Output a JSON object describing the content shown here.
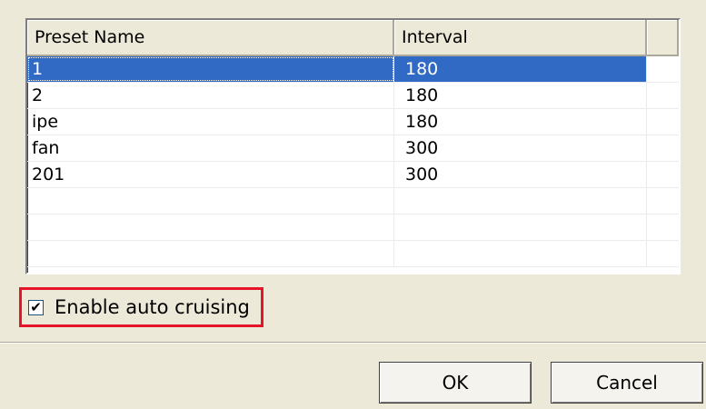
{
  "table": {
    "columns": [
      "Preset Name",
      "Interval",
      ""
    ],
    "rows": [
      {
        "name": "1",
        "interval": "180"
      },
      {
        "name": "2",
        "interval": "180"
      },
      {
        "name": "ipe",
        "interval": "180"
      },
      {
        "name": "fan",
        "interval": "300"
      },
      {
        "name": "201",
        "interval": "300"
      },
      {
        "name": "",
        "interval": ""
      },
      {
        "name": "",
        "interval": ""
      },
      {
        "name": "",
        "interval": ""
      }
    ],
    "selected_row": 0
  },
  "auto_cruise": {
    "label": "Enable auto cruising",
    "checked": true,
    "check_glyph": "✔"
  },
  "buttons": {
    "ok_label": "OK",
    "cancel_label": "Cancel"
  },
  "colors": {
    "selection": "#316ac5",
    "highlight_box": "#e6142b",
    "dialog_bg": "#ece9d8"
  }
}
